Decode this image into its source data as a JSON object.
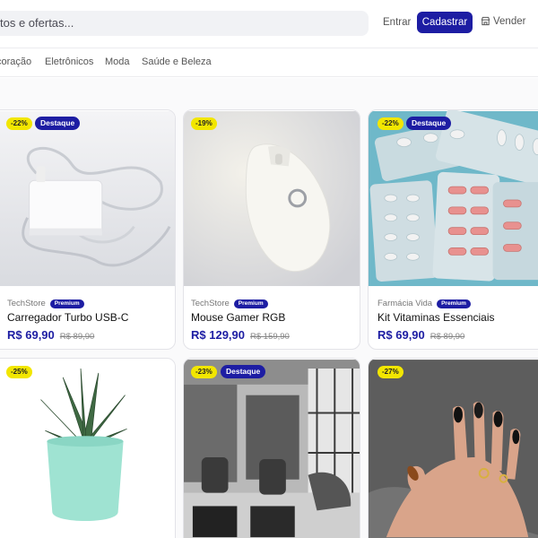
{
  "header": {
    "search_placeholder": "tos e ofertas...",
    "entrar": "Entrar",
    "cadastrar": "Cadastrar",
    "vender": "Vender"
  },
  "categories": [
    "coração",
    "Eletrônicos",
    "Moda",
    "Saúde e Beleza"
  ],
  "products": [
    {
      "discount": "-22%",
      "featured": "Destaque",
      "store": "TechStore",
      "premium": "Premium",
      "name": "Carregador Turbo USB-C",
      "price": "R$ 69,90",
      "old_price": "R$ 89,90",
      "image": "charger-image"
    },
    {
      "discount": "-19%",
      "store": "TechStore",
      "premium": "Premium",
      "name": "Mouse Gamer RGB",
      "price": "R$ 129,90",
      "old_price": "R$ 159,90",
      "image": "mouse-image"
    },
    {
      "discount": "-22%",
      "featured": "Destaque",
      "store": "Farmácia Vida",
      "premium": "Premium",
      "name": "Kit Vitaminas Essenciais",
      "price": "R$ 69,90",
      "old_price": "R$ 89,90",
      "image": "pills-image"
    },
    {
      "discount": "-25%",
      "image": "plant-image"
    },
    {
      "discount": "-23%",
      "featured": "Destaque",
      "image": "salon-image"
    },
    {
      "discount": "-27%",
      "image": "nails-image"
    }
  ],
  "colors": {
    "primary": "#1d1da3",
    "discount_badge": "#f2e600"
  }
}
